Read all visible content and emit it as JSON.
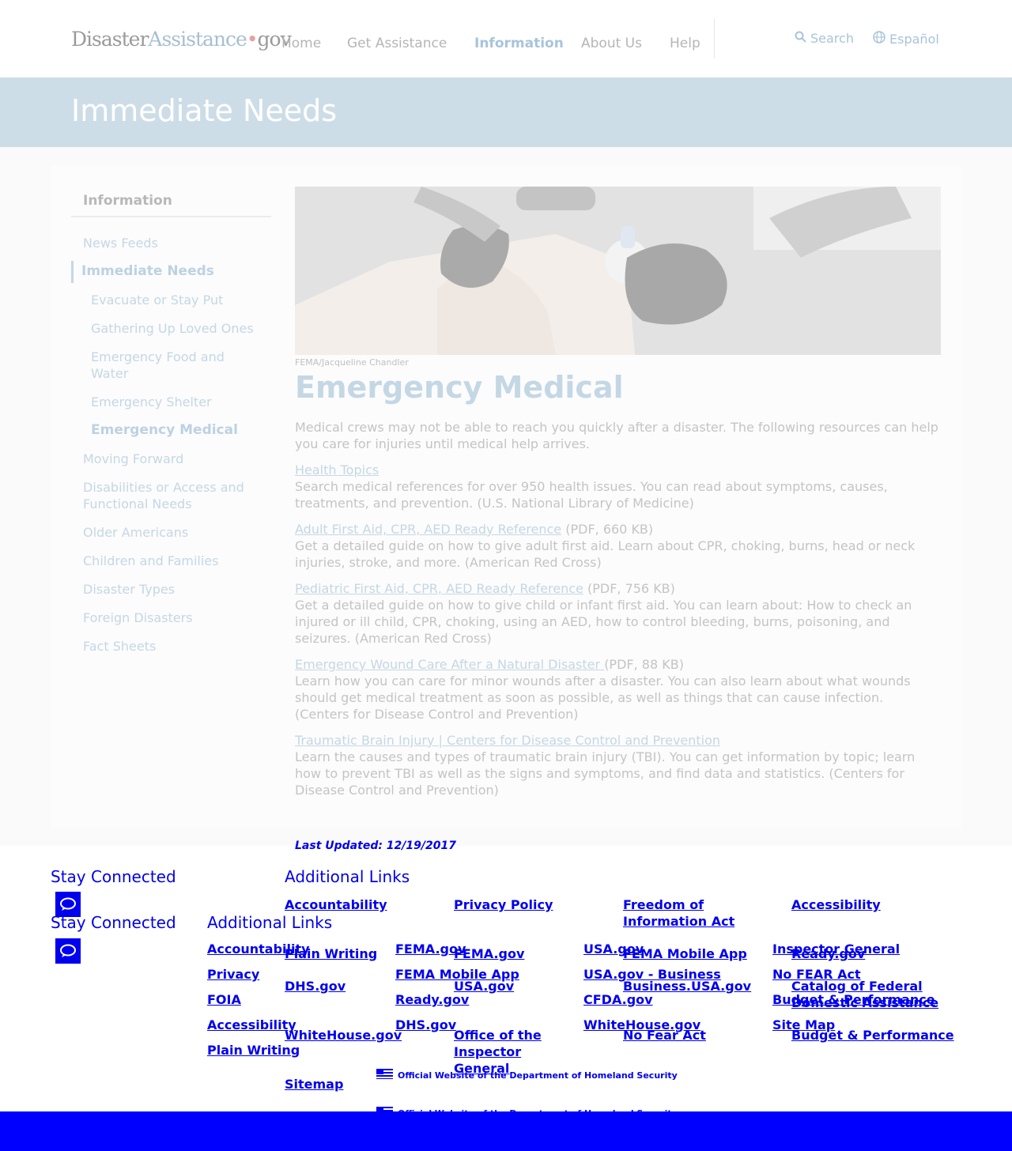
{
  "header": {
    "logo": {
      "part1": "Disaster",
      "part2": "Assistance",
      "dot": "•",
      "part3": "gov"
    },
    "nav": [
      "Home",
      "Get Assistance",
      "Information",
      "About Us",
      "Help"
    ],
    "search": "Search",
    "language": "Español"
  },
  "banner": {
    "title": "Immediate Needs"
  },
  "sidebar": {
    "heading": "Information",
    "items": [
      "News Feeds",
      "Immediate Needs",
      "Evacuate or Stay Put",
      "Gathering Up Loved Ones",
      "Emergency Food and Water",
      "Emergency Shelter",
      "Emergency Medical",
      "Moving Forward",
      "Disabilities or Access and Functional Needs",
      "Older Americans",
      "Children and Families",
      "Disaster Types",
      "Foreign Disasters",
      "Fact Sheets"
    ]
  },
  "main": {
    "photo_credit": "FEMA/Jacqueline Chandler",
    "title": "Emergency Medical",
    "intro": "Medical crews may not be able to reach you quickly after a disaster. The following resources can help you care for injuries until medical help arrives.",
    "resources": [
      {
        "link": "Health Topics",
        "meta": "",
        "desc": "Search medical references for over 950 health issues. You can read about symptoms, causes, treatments, and prevention. (U.S. National Library of Medicine)"
      },
      {
        "link": "Adult First Aid, CPR, AED Ready Reference",
        "meta": " (PDF, 660 KB)",
        "desc": "Get a detailed guide on how to give adult first aid. Learn about CPR, choking, burns, head or neck injuries, stroke, and more.  (American Red Cross)"
      },
      {
        "link": "Pediatric First Aid, CPR, AED Ready Reference",
        "meta": " (PDF, 756 KB)",
        "desc": "Get a detailed guide on how to give child or infant first aid. You can learn about: How to check an injured or ill child, CPR, choking, using an AED, how to control bleeding, burns, poisoning, and seizures. (American Red Cross)"
      },
      {
        "link": "Emergency Wound Care After a Natural Disaster ",
        "meta": "(PDF, 88 KB)",
        "desc": "Learn how you can care for minor wounds after a disaster. You can also learn about what wounds should get medical treatment as soon as possible, as well as things that can cause infection. (Centers for Disease Control and Prevention)"
      },
      {
        "link": "Traumatic Brain Injury | Centers for Disease Control and Prevention",
        "meta": "",
        "desc": "Learn the causes and types of traumatic brain injury (TBI). You can get information by topic; learn how to prevent TBI as well as the signs and symptoms, and find data and statistics. (Centers for Disease Control and Prevention)"
      }
    ],
    "last_updated": "Last Updated: 12/19/2017"
  },
  "footer": {
    "stay_connected": "Stay Connected",
    "additional_links": "Additional Links",
    "grid_a": [
      "Accountability",
      "Privacy Policy",
      "Freedom of Information Act",
      "Accessibility",
      "Plain Writing",
      "FEMA.gov",
      "FEMA Mobile App",
      "Ready.gov",
      "DHS.gov",
      "USA.gov",
      "Business.USA.gov",
      "Catalog of Federal Domestic Assistance",
      "WhiteHouse.gov",
      "Office of the Inspector General",
      "No Fear Act",
      "Budget & Performance",
      "Sitemap"
    ],
    "grid_b": [
      "Accountability",
      "Privacy",
      "FOIA",
      "Accessibility",
      "Plain Writing",
      "FEMA.gov",
      "FEMA Mobile App",
      "Ready.gov",
      "DHS.gov",
      "USA.gov",
      "USA.gov - Business",
      "CFDA.gov",
      "WhiteHouse.gov",
      "Inspector General",
      "No FEAR Act",
      "Budget & Performance",
      "Site Map"
    ],
    "dhs_text": "Official Website of the Department of Homeland Security"
  }
}
